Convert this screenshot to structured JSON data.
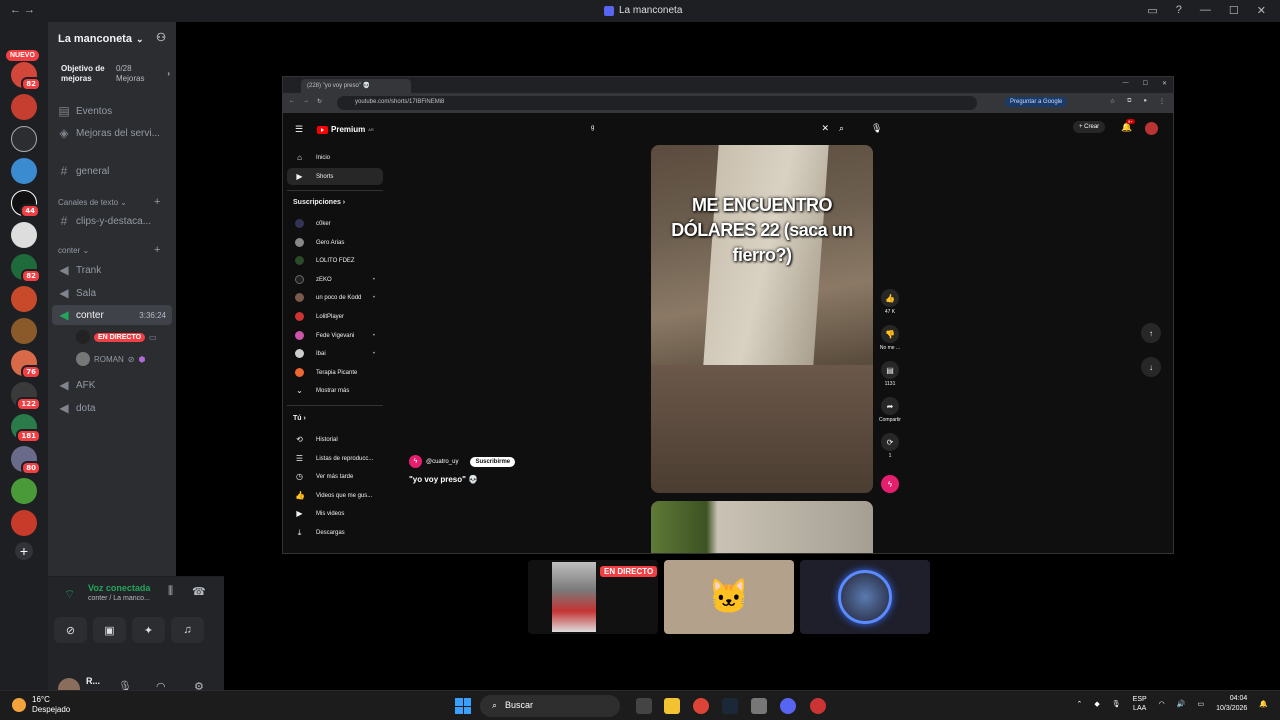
{
  "window": {
    "title": "La manconeta"
  },
  "servers": {
    "nuevo": "NUEVO",
    "badges": [
      "82",
      "44",
      "82",
      "76",
      "122",
      "181",
      "80"
    ]
  },
  "guild": {
    "name": "La manconeta"
  },
  "boost": {
    "label": "Objetivo de mejoras",
    "count": "0/28 Mejoras"
  },
  "channels": {
    "eventos": "Eventos",
    "mejoras": "Mejoras del servi...",
    "general": "general",
    "cat_text": "Canales de texto",
    "clips": "clips-y-destaca...",
    "cat_conter": "conter",
    "trank": "Trank",
    "sala": "Sala",
    "conter": "conter",
    "conter_time": "3:36:24",
    "live": "EN DIRECTO",
    "roman": "ROMAN",
    "afk": "AFK",
    "dota": "dota"
  },
  "voice": {
    "status": "Voz conectada",
    "sub": "conter / La manco..."
  },
  "panel": {
    "name": "R..."
  },
  "browser": {
    "tab": "(228) \"yo voy preso\" 💀",
    "url": "youtube.com/shorts/17IBFiNEMi8",
    "ask": "Preguntar a Google"
  },
  "yt": {
    "brand": "Premium",
    "brand_sup": "AR",
    "search": "g",
    "crear": "Crear",
    "notif": "9+",
    "nav": {
      "inicio": "Inicio",
      "shorts": "Shorts"
    },
    "subs_header": "Suscripciones",
    "subs": [
      "c0ker",
      "Gero Arias",
      "LOLITO FDEZ",
      "zEKO",
      "un poco de Kodd",
      "LolitPlayer",
      "Fede Vigevani",
      "Ibai",
      "Terapia Picante"
    ],
    "show_more": "Mostrar más",
    "you_header": "Tú",
    "you": [
      "Historial",
      "Listas de reproducc...",
      "Ver más tarde",
      "Videos que me gus...",
      "Mis videos",
      "Descargas"
    ],
    "channel": "@cuatro_uy",
    "subscribe": "Suscribirme",
    "video_title": "\"yo voy preso\" 💀",
    "overlay": "ME ENCUENTRO DÓLARES 22 (saca un fierro?)",
    "likes": "47 K",
    "dislike": "No me ...",
    "comments": "1131",
    "share": "Compartir",
    "remix": "1"
  },
  "streams": {
    "live": "EN DIRECTO"
  },
  "taskbar": {
    "temp": "16°C",
    "weather": "Despejado",
    "search": "Buscar",
    "lang1": "ESP",
    "lang2": "LAA",
    "time": "04:04",
    "date": "10/3/2026"
  }
}
